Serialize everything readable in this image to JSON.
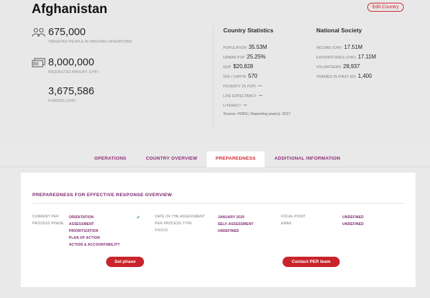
{
  "country": {
    "name": "Afghanistan",
    "edit_label": "Edit Country"
  },
  "stats": [
    {
      "icon": "people-icon",
      "value": "675,000",
      "label": "TARGETED PEOPLE IN ONGOING OPERATIONS"
    },
    {
      "icon": "money-icon",
      "value": "8,000,000",
      "label": "REQUESTED AMOUNT (CHF)"
    },
    {
      "icon": "",
      "value": "3,675,586",
      "label": "FUNDING (CHF)"
    }
  ],
  "country_statistics": {
    "heading": "Country Statistics",
    "rows": [
      {
        "label": "POPULATION",
        "value": "35.53M"
      },
      {
        "label": "URBAN POP",
        "value": "25.25%"
      },
      {
        "label": "GDP",
        "value": "$20,828"
      },
      {
        "label": "GNI / CAPITA",
        "value": "570"
      },
      {
        "label": "POVERTY (% POP)",
        "value": "--"
      },
      {
        "label": "LIFE EXPECTANCY",
        "value": "--"
      },
      {
        "label": "LITERACY",
        "value": "--"
      }
    ],
    "source": "Source: FDRS | Reporting year(s): 2017"
  },
  "national_society": {
    "heading": "National Society",
    "rows": [
      {
        "label": "INCOME (CHF)",
        "value": "17.51M"
      },
      {
        "label": "EXPENDITURES (CHF)",
        "value": "17.11M"
      },
      {
        "label": "VOLUNTEERS",
        "value": "28,937"
      },
      {
        "label": "TRAINED IN FIRST AID",
        "value": "1,400"
      }
    ]
  },
  "tabs": [
    {
      "label": "OPERATIONS",
      "active": false
    },
    {
      "label": "COUNTRY OVERVIEW",
      "active": false
    },
    {
      "label": "PREPAREDNESS",
      "active": true
    },
    {
      "label": "ADDITIONAL INFORMATION",
      "active": false
    }
  ],
  "preparedness": {
    "title": "PREPAREDNESS FOR EFFECTIVE RESPONSE OVERVIEW",
    "phase_label_1": "CURRENT PER",
    "phase_label_2": "PROCESS PHASE",
    "phases": [
      "ORIENTATION",
      "ASSESSMENT",
      "PRIORITIZATION",
      "PLAN OF ACTION",
      "ACTION & ACCOUNTABILITY"
    ],
    "assessment_labels": [
      "DATE OF THE ASSESSMENT",
      "PER PROCESS TYPE",
      "FOCUS"
    ],
    "assessment_values": [
      "JANUARY 2020",
      "SELF-ASSESSMENT",
      "UNDEFINED"
    ],
    "focal_labels": [
      "FOCAL POINT",
      "EMAIL"
    ],
    "focal_values": [
      "UNDEFINED",
      "UNDEFINED"
    ],
    "set_phase_label": "Set phase",
    "contact_label": "Contact PER team"
  },
  "colors": {
    "accent": "#c9242b",
    "purple": "#7a1f6a",
    "check": "#2aa84a"
  }
}
